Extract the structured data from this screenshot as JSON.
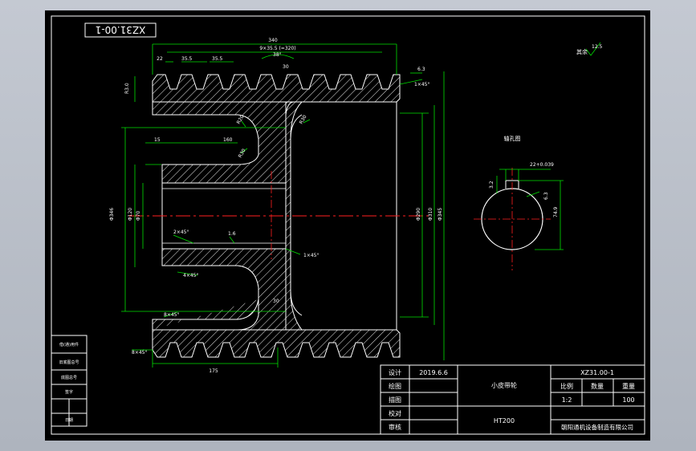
{
  "drawing": {
    "code_box": "XZ31.00-1",
    "code_box_mirrored": true
  },
  "title_block": {
    "rows": [
      "设计",
      "绘图",
      "描图",
      "校对",
      "审核"
    ],
    "date": "2019.6.6",
    "part_name": "小皮带轮",
    "material": "HT200",
    "drawing_no": "XZ31.00-1",
    "headers": [
      "比例",
      "数量",
      "重量"
    ],
    "values": [
      "1:2",
      "",
      "100"
    ],
    "company": "朝阳通机设备制造有限公司"
  },
  "side_table": {
    "rows": [
      "借(通)用件",
      "旧底图总号",
      "底图总号",
      "签字",
      "日期"
    ]
  },
  "dimensions": {
    "total_width": "340",
    "groove_pitch": "9×35.5 (=320)",
    "pitch": "35.5",
    "left_offset": "22",
    "top_angle": "38°",
    "sec_angle": "30",
    "groove_chamfer": "1×45°",
    "roughness_top": "6.3",
    "side_dim": "R3.0",
    "radius_r20": "R20",
    "radius_r30": "R30",
    "hub_len": "160",
    "left_dim": "15",
    "dia_outer": "Φ346",
    "dia_hub": "Φ120",
    "dia_bore": "Φ70",
    "dia_inner_right": "Φ290",
    "dia_right2": "Φ310",
    "dia_right3": "Φ345",
    "chamfer_1": "2×45°",
    "chamfer_2": "1×45°",
    "chamfer_3": "4×45°",
    "chamfer_4": "8×45°",
    "small_dim": "1.6",
    "bottom_dim": "175",
    "web_dim": "30",
    "section_title": "轴孔图",
    "keyway_dim": "22+0.039",
    "key_height": "74.9",
    "roughness_key": "3.2",
    "roughness_side": "6.3",
    "general_rough_label": "其余",
    "general_rough_val": "12.5"
  },
  "colors": {
    "line": "#ffffff",
    "hatch": "#ffffff",
    "dim": "#00e000",
    "center": "#ff2020",
    "text": "#ffffff",
    "frame": "#ffffff"
  }
}
